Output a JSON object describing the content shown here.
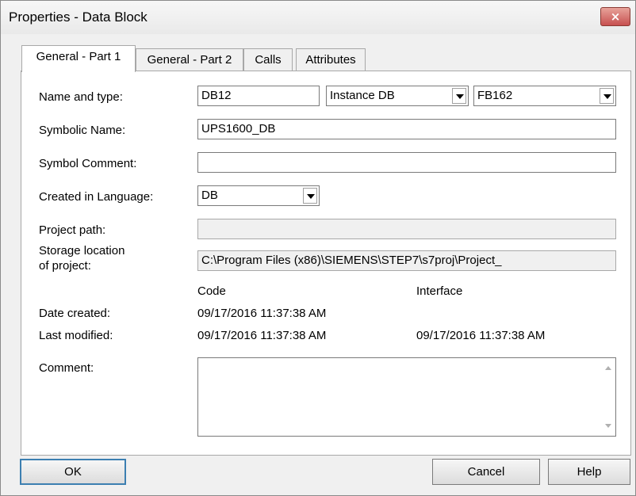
{
  "window": {
    "title": "Properties - Data Block",
    "close_label": "×"
  },
  "tabs": [
    {
      "label": "General - Part 1",
      "active": true
    },
    {
      "label": "General - Part 2",
      "active": false
    },
    {
      "label": "Calls",
      "active": false
    },
    {
      "label": "Attributes",
      "active": false
    }
  ],
  "form": {
    "name_type_label": "Name and type:",
    "name_value": "DB12",
    "type_value": "Instance DB",
    "fb_value": "FB162",
    "symbolic_name_label": "Symbolic Name:",
    "symbolic_name_value": "UPS1600_DB",
    "symbol_comment_label": "Symbol Comment:",
    "symbol_comment_value": "",
    "language_label": "Created in Language:",
    "language_value": "DB",
    "project_path_label": "Project path:",
    "project_path_value": "",
    "storage_label_line1": "Storage location",
    "storage_label_line2": "of project:",
    "storage_value": "C:\\Program Files (x86)\\SIEMENS\\STEP7\\s7proj\\Project_",
    "code_header": "Code",
    "interface_header": "Interface",
    "date_created_label": "Date created:",
    "date_created_code": "09/17/2016 11:37:38 AM",
    "last_modified_label": "Last modified:",
    "last_modified_code": "09/17/2016 11:37:38 AM",
    "last_modified_interface": "09/17/2016 11:37:38 AM",
    "comment_label": "Comment:",
    "comment_value": ""
  },
  "buttons": {
    "ok": "OK",
    "cancel": "Cancel",
    "help": "Help"
  },
  "icons": {
    "close": "close-icon",
    "dropdown": "chevron-down-icon",
    "scroll_up": "scroll-up-icon",
    "scroll_down": "scroll-down-icon"
  },
  "colors": {
    "close_button": "#c75050",
    "panel_bg": "#ffffff",
    "dialog_bg": "#f0f0f0"
  }
}
